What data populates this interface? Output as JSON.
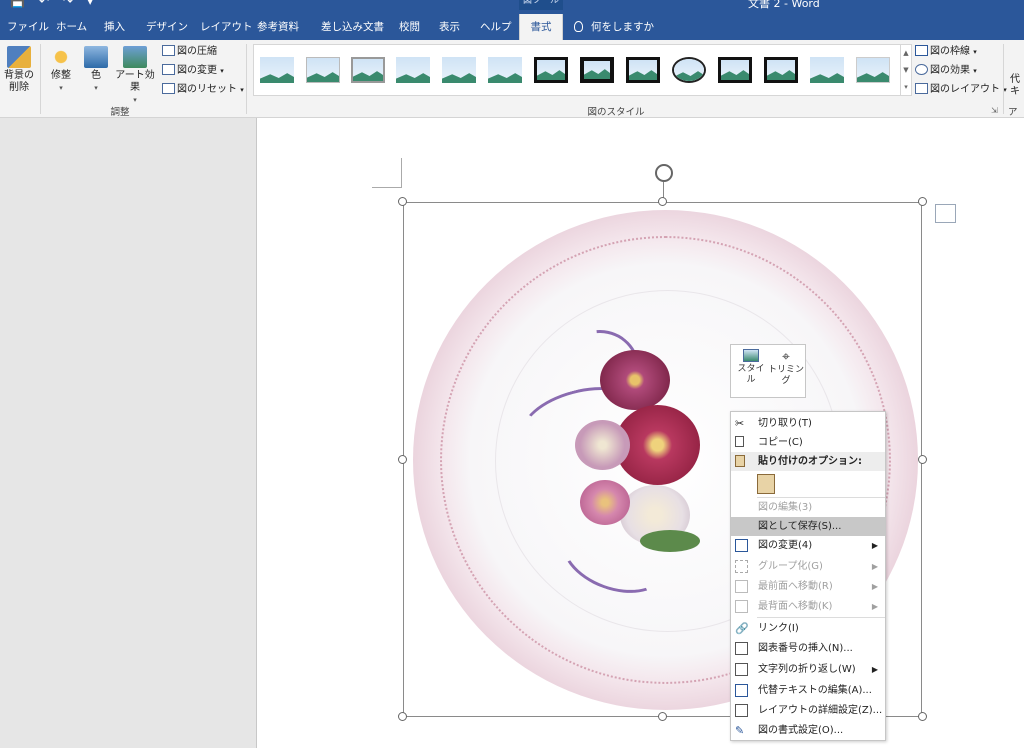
{
  "window": {
    "context_tab_group": "図ツール",
    "document_title": "文書 2 - Word"
  },
  "tabs": [
    "ファイル",
    "ホーム",
    "挿入",
    "デザイン",
    "レイアウト",
    "参考資料",
    "差し込み文書",
    "校閲",
    "表示",
    "ヘルプ",
    "書式"
  ],
  "active_tab": "書式",
  "tell_me": "何をしますか",
  "ribbon": {
    "adjust": {
      "remove_bg_line1": "背景の",
      "remove_bg_line2": "削除",
      "corrections": "修整",
      "color": "色",
      "artistic": "アート効果",
      "compress": "図の圧縮",
      "change": "図の変更",
      "reset": "図のリセット",
      "group_label": "調整"
    },
    "styles": {
      "group_label": "図のスタイル",
      "border": "図の枠線",
      "effects": "図の効果",
      "layout": "図のレイアウト"
    },
    "accessibility": {
      "label_partial": "アク",
      "alt_line1": "代",
      "alt_line2": "キ"
    }
  },
  "mini_toolbar": {
    "style_line1": "スタイ",
    "style_line2": "ル",
    "trim": "トリミング"
  },
  "context_menu": [
    {
      "label": "切り取り(T)",
      "icon": "scissors-icon",
      "state": "normal"
    },
    {
      "label": "コピー(C)",
      "icon": "copy-icon",
      "state": "normal"
    },
    {
      "label": "貼り付けのオプション:",
      "icon": "paste-icon",
      "state": "header"
    },
    {
      "label": "図の編集(3)",
      "icon": "",
      "state": "disabled"
    },
    {
      "label": "図として保存(S)...",
      "icon": "",
      "state": "hover"
    },
    {
      "label": "図の変更(4)",
      "icon": "change-picture-icon",
      "state": "normal",
      "submenu": true
    },
    {
      "label": "グループ化(G)",
      "icon": "group-icon",
      "state": "disabled",
      "submenu": true
    },
    {
      "label": "最前面へ移動(R)",
      "icon": "bring-front-icon",
      "state": "disabled",
      "submenu": true
    },
    {
      "label": "最背面へ移動(K)",
      "icon": "send-back-icon",
      "state": "disabled",
      "submenu": true
    },
    {
      "label": "リンク(I)",
      "icon": "link-icon",
      "state": "normal"
    },
    {
      "label": "図表番号の挿入(N)...",
      "icon": "caption-icon",
      "state": "normal"
    },
    {
      "label": "文字列の折り返し(W)",
      "icon": "wrap-text-icon",
      "state": "normal",
      "submenu": true
    },
    {
      "label": "代替テキストの編集(A)...",
      "icon": "alt-text-icon",
      "state": "normal"
    },
    {
      "label": "レイアウトの詳細設定(Z)...",
      "icon": "layout-icon",
      "state": "normal"
    },
    {
      "label": "図の書式設定(O)...",
      "icon": "format-picture-icon",
      "state": "normal"
    }
  ],
  "colors": {
    "title_blue": "#2b579a",
    "ribbon_bg": "#f3f3f3",
    "hover_gray": "#c8c8c8"
  }
}
